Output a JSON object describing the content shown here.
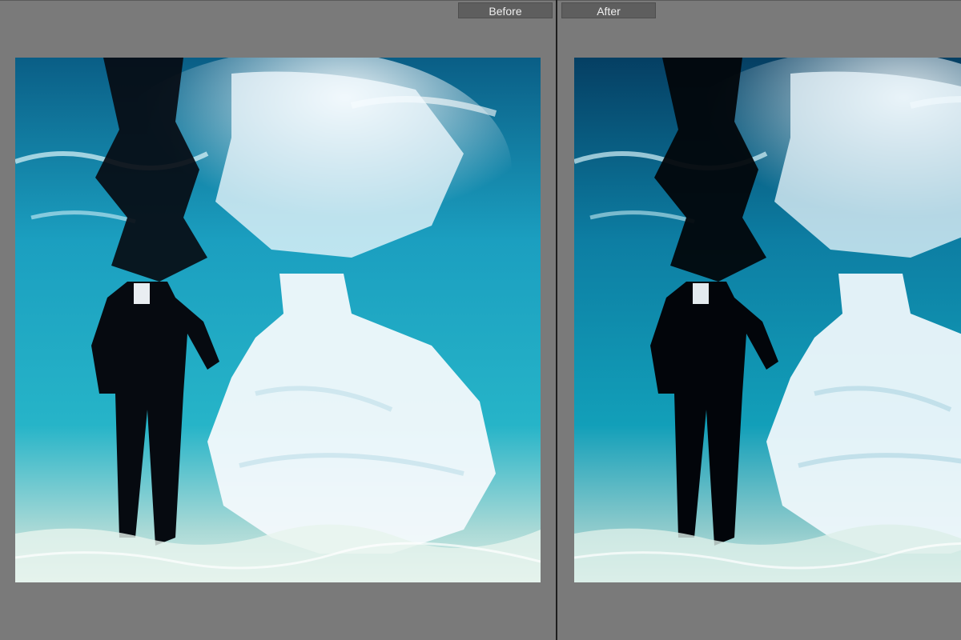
{
  "compare_view": {
    "before_label": "Before",
    "after_label": "After"
  },
  "colors": {
    "workspace_bg": "#7a7a7a",
    "label_bg": "#5e5e5e",
    "divider": "#1e1e1e",
    "water_before": "#1a9fba",
    "water_after": "#0f7fa0"
  }
}
